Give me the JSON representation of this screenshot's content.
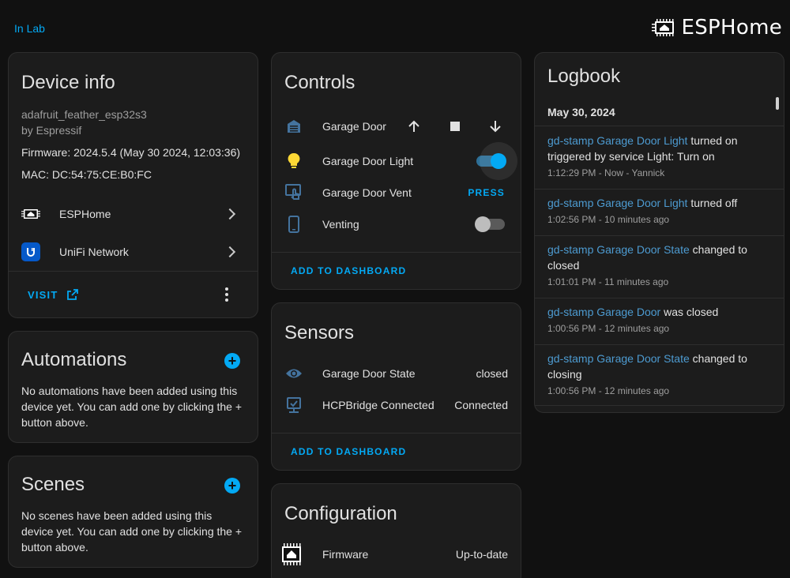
{
  "header": {
    "area": "In Lab",
    "brand": "ESPHome"
  },
  "device_info": {
    "title": "Device info",
    "model": "adafruit_feather_esp32s3",
    "manufacturer": "by Espressif",
    "firmware": "Firmware: 2024.5.4 (May 30 2024, 12:03:36)",
    "mac": "MAC: DC:54:75:CE:B0:FC",
    "integrations": [
      {
        "label": "ESPHome",
        "icon": "esphome-icon"
      },
      {
        "label": "UniFi Network",
        "icon": "unifi-icon"
      }
    ],
    "visit_label": "VISIT"
  },
  "automations": {
    "title": "Automations",
    "text": "No automations have been added using this device yet. You can add one by clicking the + button above."
  },
  "scenes": {
    "title": "Scenes",
    "text": "No scenes have been added using this device yet. You can add one by clicking the + button above."
  },
  "controls": {
    "title": "Controls",
    "items": [
      {
        "label": "Garage Door",
        "icon": "garage-icon"
      },
      {
        "label": "Garage Door Light",
        "icon": "lightbulb-icon",
        "state": "on"
      },
      {
        "label": "Garage Door Vent",
        "icon": "gesture-tap-icon",
        "action": "PRESS"
      },
      {
        "label": "Venting",
        "icon": "cellphone-icon",
        "state": "off"
      }
    ],
    "add_label": "ADD TO DASHBOARD"
  },
  "sensors": {
    "title": "Sensors",
    "items": [
      {
        "label": "Garage Door State",
        "value": "closed",
        "icon": "eye-icon"
      },
      {
        "label": "HCPBridge Connected",
        "value": "Connected",
        "icon": "monitor-check-icon"
      }
    ],
    "add_label": "ADD TO DASHBOARD"
  },
  "configuration": {
    "title": "Configuration",
    "items": [
      {
        "label": "Firmware",
        "value": "Up-to-date",
        "icon": "esphome-chip-icon"
      }
    ]
  },
  "logbook": {
    "title": "Logbook",
    "date": "May 30, 2024",
    "entries": [
      {
        "entity": "gd-stamp Garage Door Light",
        "text": " turned on triggered by service Light: Turn on",
        "time": "1:12:29 PM - Now - Yannick"
      },
      {
        "entity": "gd-stamp Garage Door Light",
        "text": " turned off",
        "time": "1:02:56 PM - 10 minutes ago"
      },
      {
        "entity": "gd-stamp Garage Door State",
        "text": " changed to closed",
        "time": "1:01:01 PM - 11 minutes ago"
      },
      {
        "entity": "gd-stamp Garage Door",
        "text": " was closed",
        "time": "1:00:56 PM - 12 minutes ago"
      },
      {
        "entity": "gd-stamp Garage Door State",
        "text": " changed to closing",
        "time": "1:00:56 PM - 12 minutes ago"
      }
    ]
  },
  "colors": {
    "background": "#111111",
    "card": "#1c1c1c",
    "accent": "#03a9f4",
    "logbook_entity": "#4d9bd1",
    "light_on": "#fdd835",
    "icon": "#44739e"
  }
}
